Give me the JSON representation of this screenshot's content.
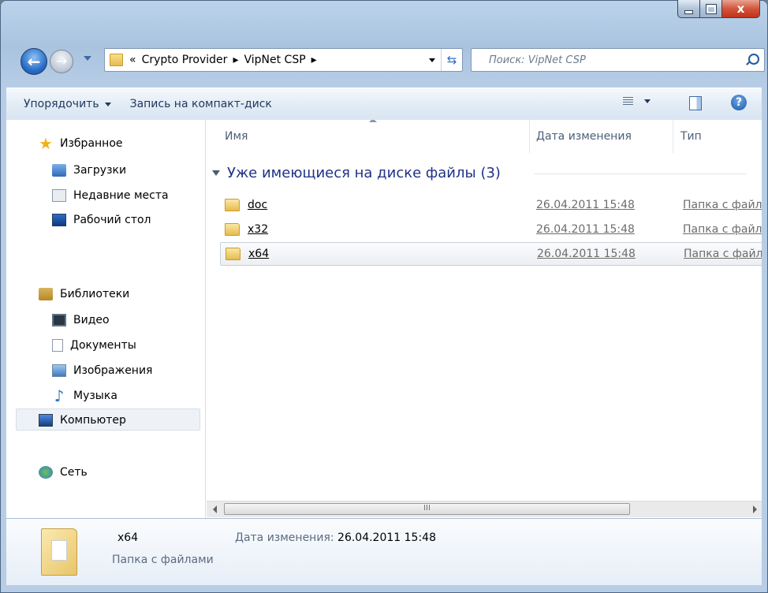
{
  "window": {
    "close_glyph": "x"
  },
  "address": {
    "crumbs": [
      "«",
      "Crypto Provider",
      "▸",
      "VipNet CSP",
      "▸"
    ]
  },
  "search": {
    "placeholder": "Поиск: VipNet CSP"
  },
  "toolbar": {
    "organize": "Упорядочить",
    "burn": "Запись на компакт-диск",
    "help": "?"
  },
  "nav": {
    "favorites": "Избранное",
    "downloads": "Загрузки",
    "recent": "Недавние места",
    "desktop": "Рабочий стол",
    "libraries": "Библиотеки",
    "video": "Видео",
    "documents": "Документы",
    "images": "Изображения",
    "music": "Музыка",
    "computer": "Компьютер",
    "network": "Сеть"
  },
  "columns": {
    "name": "Имя",
    "date": "Дата изменения",
    "type": "Тип"
  },
  "group": {
    "label": "Уже имеющиеся на диске файлы (3)"
  },
  "files": [
    {
      "name": "doc",
      "date": "26.04.2011 15:48",
      "type": "Папка с файл"
    },
    {
      "name": "x32",
      "date": "26.04.2011 15:48",
      "type": "Папка с файл"
    },
    {
      "name": "x64",
      "date": "26.04.2011 15:48",
      "type": "Папка с файл"
    }
  ],
  "scroll": {
    "grip": "III"
  },
  "details": {
    "name": "x64",
    "kind": "Папка с файлами",
    "modified_label": "Дата изменения:",
    "modified_value": "26.04.2011 15:48"
  }
}
